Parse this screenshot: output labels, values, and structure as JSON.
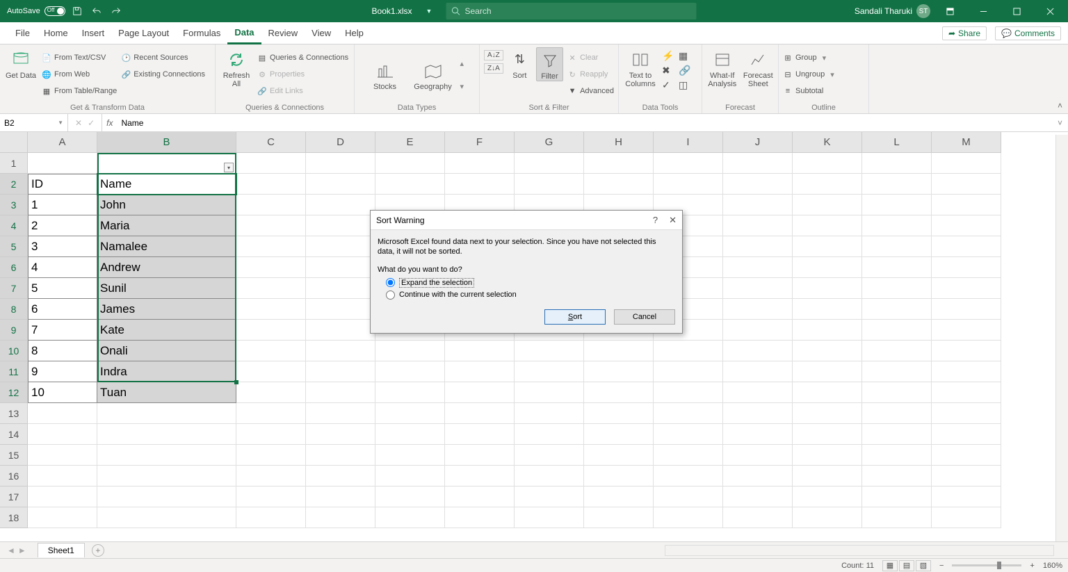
{
  "title_bar": {
    "autosave_label": "AutoSave",
    "autosave_state": "Off",
    "filename": "Book1.xlsx",
    "search_placeholder": "Search",
    "user_name": "Sandali Tharuki",
    "user_initials": "ST"
  },
  "tabs": {
    "items": [
      "File",
      "Home",
      "Insert",
      "Page Layout",
      "Formulas",
      "Data",
      "Review",
      "View",
      "Help"
    ],
    "active": "Data",
    "share": "Share",
    "comments": "Comments"
  },
  "ribbon": {
    "g1": {
      "label": "Get & Transform Data",
      "get_data": "Get Data",
      "from_text": "From Text/CSV",
      "from_web": "From Web",
      "from_table": "From Table/Range",
      "recent": "Recent Sources",
      "existing": "Existing Connections"
    },
    "g2": {
      "label": "Queries & Connections",
      "refresh": "Refresh All",
      "queries": "Queries & Connections",
      "properties": "Properties",
      "edit_links": "Edit Links"
    },
    "g3": {
      "label": "Data Types",
      "stocks": "Stocks",
      "geography": "Geography"
    },
    "g4": {
      "label": "Sort & Filter",
      "sort": "Sort",
      "filter": "Filter",
      "clear": "Clear",
      "reapply": "Reapply",
      "advanced": "Advanced"
    },
    "g5": {
      "label": "Data Tools",
      "ttc": "Text to Columns"
    },
    "g6": {
      "label": "Forecast",
      "whatif": "What-If Analysis",
      "forecast": "Forecast Sheet"
    },
    "g7": {
      "label": "Outline",
      "group": "Group",
      "ungroup": "Ungroup",
      "subtotal": "Subtotal"
    }
  },
  "formula_bar": {
    "name_box": "B2",
    "formula": "Name"
  },
  "grid": {
    "columns": [
      "A",
      "B",
      "C",
      "D",
      "E",
      "F",
      "G",
      "H",
      "I",
      "J",
      "K",
      "L",
      "M"
    ],
    "rows": [
      1,
      2,
      3,
      4,
      5,
      6,
      7,
      8,
      9,
      10,
      11,
      12,
      13,
      14,
      15,
      16,
      17,
      18
    ],
    "data": [
      {
        "A": "",
        "B": ""
      },
      {
        "A": "ID",
        "B": "Name"
      },
      {
        "A": "1",
        "B": "John"
      },
      {
        "A": "2",
        "B": "Maria"
      },
      {
        "A": "3",
        "B": "Namalee"
      },
      {
        "A": "4",
        "B": "Andrew"
      },
      {
        "A": "5",
        "B": "Sunil"
      },
      {
        "A": "6",
        "B": "James"
      },
      {
        "A": "7",
        "B": "Kate"
      },
      {
        "A": "8",
        "B": "Onali"
      },
      {
        "A": "9",
        "B": "Indra"
      },
      {
        "A": "10",
        "B": "Tuan"
      }
    ],
    "selected_col": "B",
    "selected_rows": [
      2,
      3,
      4,
      5,
      6,
      7,
      8,
      9,
      10,
      11,
      12
    ],
    "active_cell": "B2"
  },
  "dialog": {
    "title": "Sort Warning",
    "message": "Microsoft Excel found data next to your selection.  Since you have not selected this data, it will not be sorted.",
    "question": "What do you want to do?",
    "opt1": "Expand the selection",
    "opt2": "Continue with the current selection",
    "sort_btn": "Sort",
    "cancel_btn": "Cancel"
  },
  "sheet_bar": {
    "sheet1": "Sheet1"
  },
  "status_bar": {
    "count_label": "Count:",
    "count_value": "11",
    "zoom": "160%"
  }
}
